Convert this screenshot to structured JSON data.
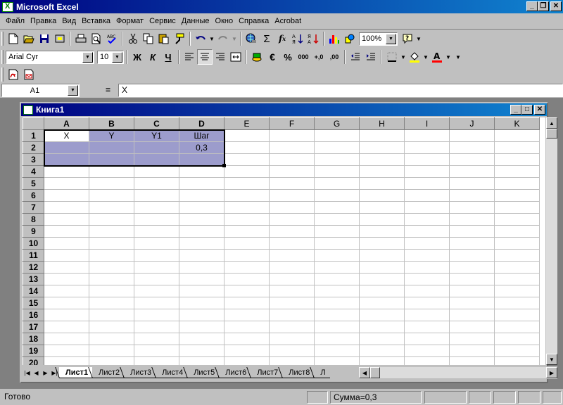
{
  "app": {
    "title": "Microsoft Excel",
    "win_buttons": {
      "minimize": "_",
      "restore": "❐",
      "close": "✕"
    }
  },
  "menu": [
    "Файл",
    "Правка",
    "Вид",
    "Вставка",
    "Формат",
    "Сервис",
    "Данные",
    "Окно",
    "Справка",
    "Acrobat"
  ],
  "standard_toolbar": {
    "zoom": "100%"
  },
  "format_toolbar": {
    "font": "Arial Cyr",
    "size": "10",
    "bold": "Ж",
    "italic": "К",
    "underline": "Ч",
    "currency": "€",
    "percent": "%",
    "thousands": "000",
    "inc_decimal": "+,0",
    "dec_decimal": ",00"
  },
  "formula_bar": {
    "name_box": "A1",
    "equals": "=",
    "content": "X"
  },
  "workbook": {
    "title": "Книга1",
    "columns": [
      "A",
      "B",
      "C",
      "D",
      "E",
      "F",
      "G",
      "H",
      "I",
      "J",
      "K"
    ],
    "rows": [
      "1",
      "2",
      "3",
      "4",
      "5",
      "6",
      "7",
      "8",
      "9",
      "10",
      "11",
      "12",
      "13",
      "14",
      "15",
      "16",
      "17",
      "18",
      "19",
      "20"
    ],
    "cells": {
      "A1": "X",
      "B1": "Y",
      "C1": "Y1",
      "D1": "Шаг",
      "D2": "0,3"
    },
    "sheets": [
      "Лист1",
      "Лист2",
      "Лист3",
      "Лист4",
      "Лист5",
      "Лист6",
      "Лист7",
      "Лист8",
      "Л"
    ]
  },
  "status": {
    "ready": "Готово",
    "sum": "Сумма=0,3"
  }
}
